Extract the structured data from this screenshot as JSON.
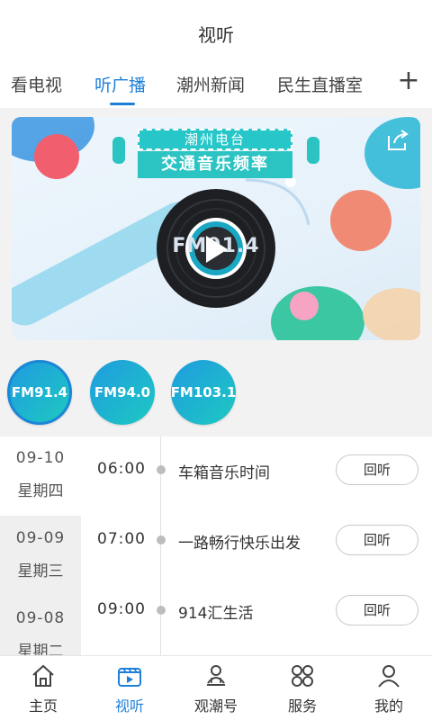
{
  "header": {
    "title": "视听"
  },
  "tabs": [
    {
      "label": "看电视"
    },
    {
      "label": "听广播"
    },
    {
      "label": "潮州新闻"
    },
    {
      "label": "民生直播室"
    }
  ],
  "tab_add_icon": "plus-icon",
  "banner": {
    "badge": "潮州电台",
    "title": "交通音乐频率",
    "disc_label": "FM91.4",
    "share_icon": "share-icon",
    "play_icon": "play-icon"
  },
  "frequencies": [
    {
      "label": "FM91.4",
      "active": true
    },
    {
      "label": "FM94.0",
      "active": false
    },
    {
      "label": "FM103.1",
      "active": false
    }
  ],
  "dates": [
    {
      "date": "09-10",
      "weekday": "星期四",
      "active": true
    },
    {
      "date": "09-09",
      "weekday": "星期三",
      "active": false
    },
    {
      "date": "09-08",
      "weekday": "星期二",
      "active": false
    }
  ],
  "programs": [
    {
      "time": "06:00",
      "name": "车箱音乐时间",
      "action": "回听"
    },
    {
      "time": "07:00",
      "name": "一路畅行快乐出发",
      "action": "回听"
    },
    {
      "time": "09:00",
      "name": "914汇生活",
      "action": "回听"
    }
  ],
  "nav": [
    {
      "label": "主页",
      "icon": "home-icon"
    },
    {
      "label": "视听",
      "icon": "video-icon"
    },
    {
      "label": "观潮号",
      "icon": "profile-badge-icon"
    },
    {
      "label": "服务",
      "icon": "services-grid-icon"
    },
    {
      "label": "我的",
      "icon": "user-icon"
    }
  ],
  "colors": {
    "accent": "#1e7fd8",
    "teal": "#2bc4c3",
    "muted_bg": "#f2f2f2"
  }
}
